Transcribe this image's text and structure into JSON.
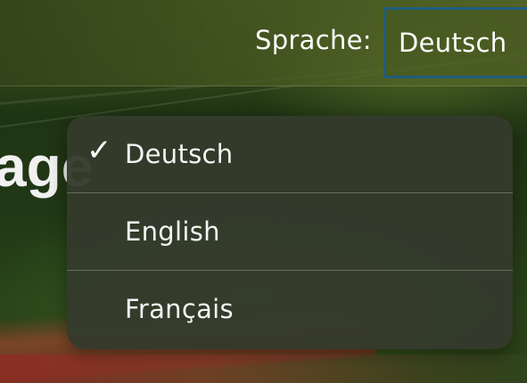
{
  "header": {
    "language_label": "Sprache:",
    "language_selected": "Deutsch"
  },
  "page": {
    "heading_fragment": "age"
  },
  "language_menu": {
    "check_glyph": "✓",
    "items": [
      {
        "label": "Deutsch",
        "selected": true
      },
      {
        "label": "English",
        "selected": false
      },
      {
        "label": "Français",
        "selected": false
      }
    ]
  },
  "colors": {
    "select_border": "#1f5d80",
    "menu_background": "#343a2c",
    "text": "#ffffff"
  },
  "icons": {
    "selected_marker": "checkmark-icon"
  }
}
